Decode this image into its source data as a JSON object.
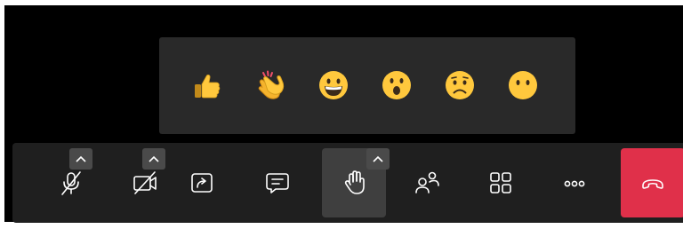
{
  "colors": {
    "stage_background": "#000000",
    "reaction_panel": "#292929",
    "toolbar": "#1f1f1f",
    "toolbar_active": "#3f3f3f",
    "caret_button": "#4a4a4a",
    "icon": "#ffffff",
    "hangup": "#e0304a",
    "emoji_yellow": "#ffc83d"
  },
  "reactions": [
    {
      "id": "like",
      "icon": "thumbs-up-icon"
    },
    {
      "id": "applause",
      "icon": "clapping-hands-icon"
    },
    {
      "id": "laugh",
      "icon": "grinning-face-icon"
    },
    {
      "id": "surprised",
      "icon": "surprised-face-icon"
    },
    {
      "id": "sad",
      "icon": "sad-face-icon"
    },
    {
      "id": "neutral",
      "icon": "neutral-face-icon"
    }
  ],
  "toolbar": {
    "buttons": [
      {
        "id": "mic",
        "icon": "microphone-muted-icon",
        "has_caret": true,
        "active": false
      },
      {
        "id": "camera",
        "icon": "camera-off-icon",
        "has_caret": true,
        "active": false
      },
      {
        "id": "share",
        "icon": "share-screen-icon",
        "has_caret": false,
        "active": false
      },
      {
        "id": "chat",
        "icon": "chat-icon",
        "has_caret": false,
        "active": false
      },
      {
        "id": "raise-hand",
        "icon": "raise-hand-icon",
        "has_caret": true,
        "active": true
      },
      {
        "id": "participants",
        "icon": "participants-icon",
        "has_caret": false,
        "active": false
      },
      {
        "id": "view",
        "icon": "grid-view-icon",
        "has_caret": false,
        "active": false
      },
      {
        "id": "more",
        "icon": "more-options-icon",
        "has_caret": false,
        "active": false
      }
    ],
    "hangup": {
      "icon": "end-call-icon"
    }
  }
}
